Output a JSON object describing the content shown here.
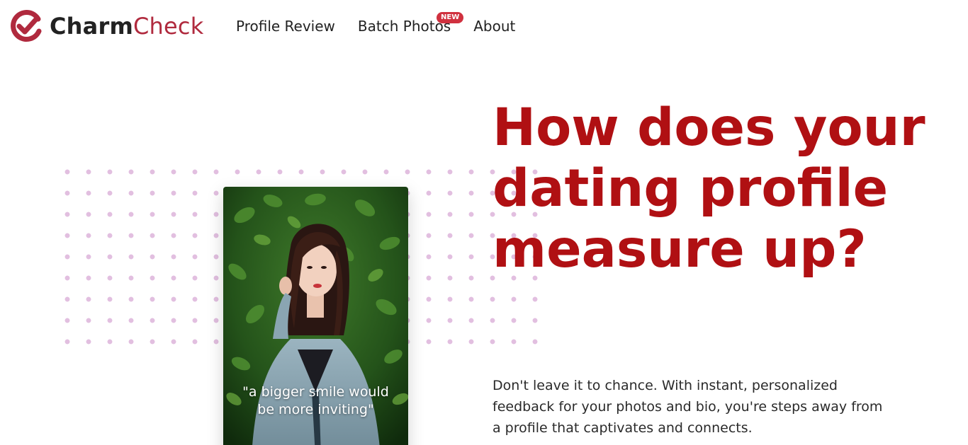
{
  "brand": {
    "name_part1": "Charm",
    "name_part2": "Check",
    "logo_icon": "check-circle-icon",
    "accent_color": "#b02a3e"
  },
  "nav": {
    "items": [
      {
        "label": "Profile Review"
      },
      {
        "label": "Batch Photos",
        "badge": "NEW"
      },
      {
        "label": "About"
      }
    ],
    "badge_color": "#d0313f"
  },
  "hero": {
    "headline": "How does your dating profile measure up?",
    "headline_color": "#b01013",
    "subtext": "Don't leave it to chance. With instant, personalized feedback for your photos and bio, you're steps away from a profile that captivates and connects.",
    "photo_quote": "\"a bigger smile would be more inviting\"",
    "dots_color": "#e2bfe0"
  }
}
